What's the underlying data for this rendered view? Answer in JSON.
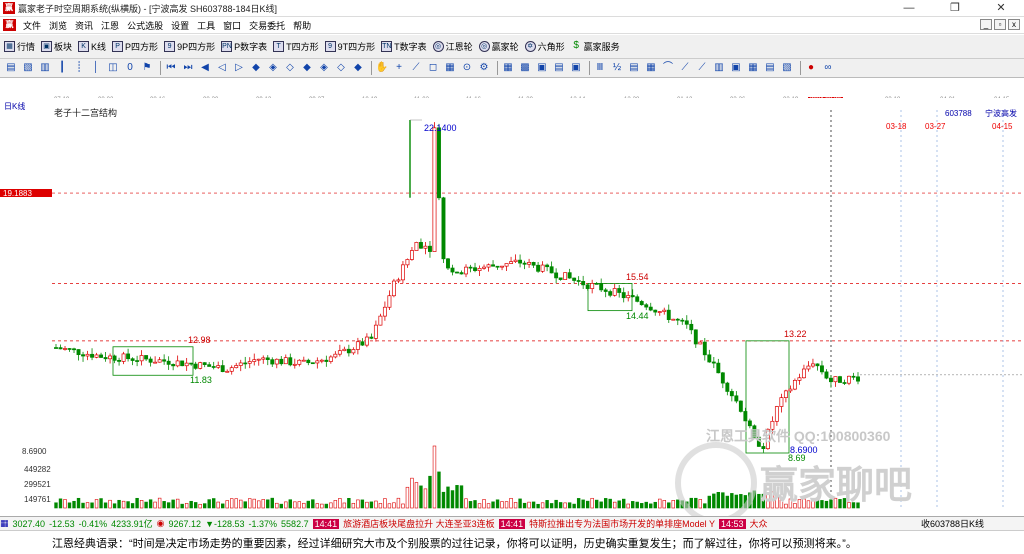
{
  "window": {
    "title": "赢家老子时空周期系统(纵横版) - [宁波高发  SH603788-184日K线]"
  },
  "menu": [
    "文件",
    "浏览",
    "资讯",
    "江恩",
    "公式选股",
    "设置",
    "工具",
    "窗口",
    "交易委托",
    "帮助"
  ],
  "toolbar": [
    {
      "icon": "grid-icon",
      "label": "行情"
    },
    {
      "icon": "blocks-icon",
      "label": "板块"
    },
    {
      "icon": "kline-icon",
      "label": "K线"
    },
    {
      "icon": "p-square-icon",
      "label": "P四方形"
    },
    {
      "icon": "nine-p-square-icon",
      "label": "9P四方形"
    },
    {
      "icon": "pn-icon",
      "label": "P数字表"
    },
    {
      "icon": "t-square-icon",
      "label": "T四方形"
    },
    {
      "icon": "nine-t-square-icon",
      "label": "9T四方形"
    },
    {
      "icon": "tn-icon",
      "label": "T数字表"
    },
    {
      "icon": "wheel-icon",
      "label": "江恩轮"
    },
    {
      "icon": "wheel-icon",
      "label": "赢家轮"
    },
    {
      "icon": "hexagon-icon",
      "label": "六角形"
    },
    {
      "icon": "dollar-icon",
      "label": "赢家服务"
    }
  ],
  "chart": {
    "period_label": "日K线",
    "structure_label": "老子十二宫结构",
    "stock_code": "603788",
    "stock_name": "宁波高发",
    "price_marker": "19.1883",
    "axis_bottom": "8.6900",
    "volume_ticks": [
      "449282",
      "299521",
      "149761"
    ],
    "annotations": [
      "22.1400",
      "12.98",
      "11.83",
      "15.54",
      "14.44",
      "13.22",
      "8.69",
      "8.6900"
    ],
    "projection_dates": [
      "03-18",
      "03-27",
      "04-15"
    ],
    "dates": [
      "07-19",
      "08-02",
      "08-16",
      "08-30",
      "09-13",
      "09-27",
      "10-19",
      "11-02",
      "11-16",
      "11-30",
      "12-14",
      "12-28",
      "01-12",
      "03-26",
      "03-26",
      "02-19",
      "2024-02-28",
      "03-18",
      "04-01",
      "04-15"
    ],
    "watermark": "江恩工具软件 QQ:100800360",
    "watermark2": "赢家聊吧"
  },
  "chart_data": {
    "type": "candlestick",
    "ylabel": "",
    "ylim": [
      8.69,
      22.14
    ],
    "key_levels": {
      "high": 22.14,
      "low": 8.69,
      "marker": 19.1883,
      "box1_high": 12.98,
      "box1_low": 11.83,
      "box2_high": 15.54,
      "box2_low": 14.44,
      "box3_high": 13.22
    }
  },
  "status": {
    "sh": "3027.40",
    "sh_chg": "-12.53",
    "sh_pct": "-0.41%",
    "sh_amt": "4233.91亿",
    "sz": "9267.12",
    "sz_chg": "▼-128.53",
    "sz_pct": "-1.37%",
    "sz_amt": "5582.7",
    "news_time1": "14:41",
    "news1": "旅游酒店板块尾盘拉升 大连圣亚3连板",
    "news_time2": "14:41",
    "news2": "特斯拉推出专为法国市场开发的单排座Model Y",
    "news_time3": "14:53",
    "news3": "大众",
    "right": "收603788日K线"
  },
  "quote": "江恩经典语录：“时间是决定市场走势的重要因素，经过详细研究大市及个别股票的过往记录，你将可以证明，历史确实重复发生；而了解过往，你将可以预测将来。”。"
}
